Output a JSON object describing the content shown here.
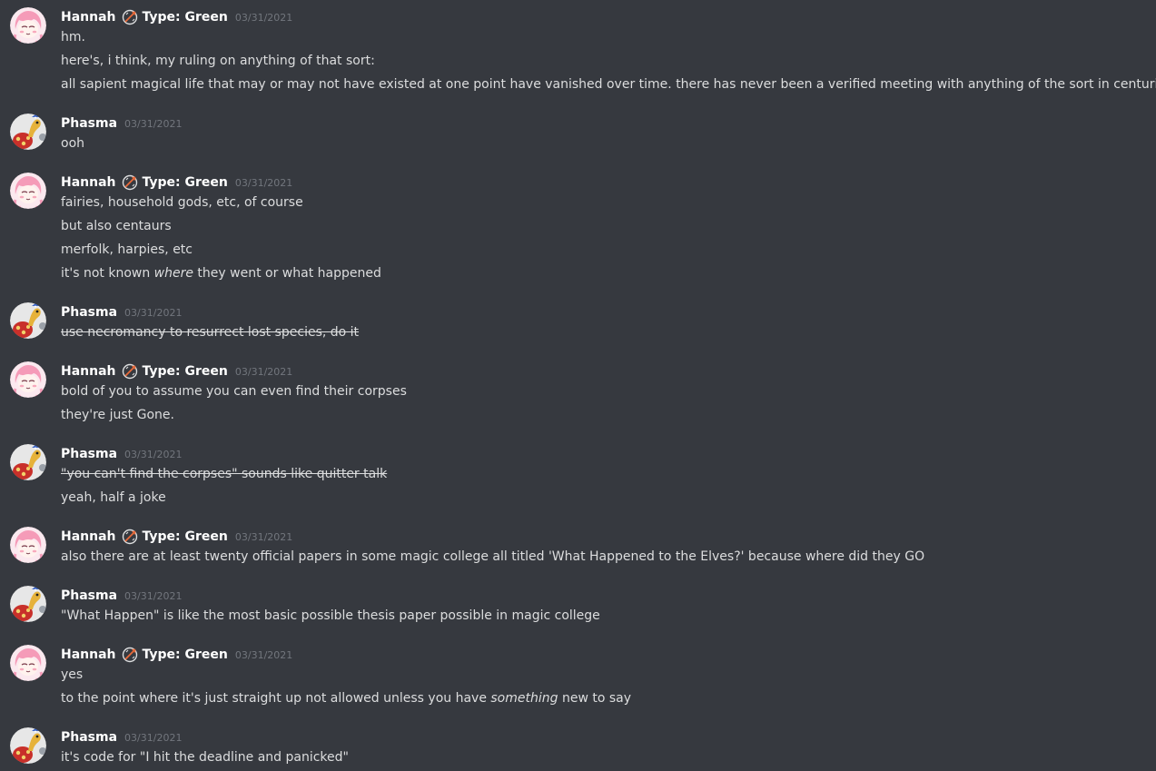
{
  "users": {
    "hannah": {
      "name": "Hannah",
      "role": "Type: Green",
      "avatar_icon": "anime-girl-pink-hair-avatar"
    },
    "phasma": {
      "name": "Phasma",
      "avatar_icon": "pokemon-shuckle-avatar"
    }
  },
  "colors": {
    "background": "#36393f",
    "text": "#dcddde",
    "username": "#ffffff",
    "timestamp": "#72767d"
  },
  "messages": [
    {
      "author": "Hannah",
      "role": "Type: Green",
      "timestamp": "03/31/2021",
      "lines": [
        {
          "text": "hm."
        },
        {
          "text": "here's, i think, my ruling on anything of that sort:"
        },
        {
          "text": "all sapient magical life that may or may not have existed at one point have vanished over time. there has never been a verified meeting with anything of the sort in centuries."
        }
      ]
    },
    {
      "author": "Phasma",
      "timestamp": "03/31/2021",
      "lines": [
        {
          "text": "ooh"
        }
      ]
    },
    {
      "author": "Hannah",
      "role": "Type: Green",
      "timestamp": "03/31/2021",
      "lines": [
        {
          "text": "fairies, household gods, etc, of course"
        },
        {
          "text": "but also centaurs"
        },
        {
          "text": "merfolk, harpies, etc"
        },
        {
          "pre": "it's not known ",
          "em": "where",
          "post": " they went or what happened"
        }
      ]
    },
    {
      "author": "Phasma",
      "timestamp": "03/31/2021",
      "lines": [
        {
          "strike": "use necromancy to resurrect lost species, do it"
        }
      ]
    },
    {
      "author": "Hannah",
      "role": "Type: Green",
      "timestamp": "03/31/2021",
      "lines": [
        {
          "text": "bold of you to assume you can even find their corpses"
        },
        {
          "text": "they're just Gone."
        }
      ]
    },
    {
      "author": "Phasma",
      "timestamp": "03/31/2021",
      "lines": [
        {
          "strike": "\"you can't find the corpses\" sounds like quitter talk"
        },
        {
          "text": "yeah, half a joke"
        }
      ]
    },
    {
      "author": "Hannah",
      "role": "Type: Green",
      "timestamp": "03/31/2021",
      "lines": [
        {
          "text": "also there are at least twenty official papers in some magic college all titled 'What Happened to the Elves?' because where did they GO"
        }
      ]
    },
    {
      "author": "Phasma",
      "timestamp": "03/31/2021",
      "lines": [
        {
          "text": "\"What Happen\" is like the most basic possible thesis paper possible in magic college"
        }
      ]
    },
    {
      "author": "Hannah",
      "role": "Type: Green",
      "timestamp": "03/31/2021",
      "lines": [
        {
          "text": "yes"
        },
        {
          "pre": "to the point where it's just straight up not allowed unless you have ",
          "em": "something",
          "post": " new to say"
        }
      ]
    },
    {
      "author": "Phasma",
      "timestamp": "03/31/2021",
      "lines": [
        {
          "text": "it's code for \"I hit the deadline and panicked\""
        }
      ]
    }
  ]
}
